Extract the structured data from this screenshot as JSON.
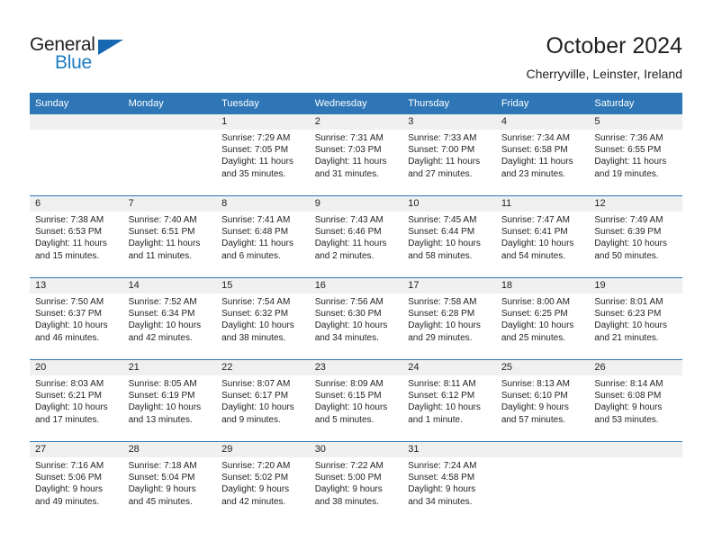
{
  "brand": {
    "name_top": "General",
    "name_bottom": "Blue",
    "triangle_icon": "triangle-icon",
    "accent_color": "#1c7cc3"
  },
  "header": {
    "title": "October 2024",
    "subtitle": "Cherryville, Leinster, Ireland"
  },
  "colors": {
    "header_blue": "#2e76b6",
    "day_band_gray": "#f0f0f0",
    "text": "#231f20"
  },
  "weekday_headers": [
    "Sunday",
    "Monday",
    "Tuesday",
    "Wednesday",
    "Thursday",
    "Friday",
    "Saturday"
  ],
  "labels": {
    "sunrise_prefix": "Sunrise:",
    "sunset_prefix": "Sunset:",
    "daylight_prefix": "Daylight:"
  },
  "weeks": [
    [
      {
        "day": "",
        "empty": true
      },
      {
        "day": "",
        "empty": true
      },
      {
        "day": "1",
        "sunrise": "Sunrise: 7:29 AM",
        "sunset": "Sunset: 7:05 PM",
        "daylight": "Daylight: 11 hours and 35 minutes."
      },
      {
        "day": "2",
        "sunrise": "Sunrise: 7:31 AM",
        "sunset": "Sunset: 7:03 PM",
        "daylight": "Daylight: 11 hours and 31 minutes."
      },
      {
        "day": "3",
        "sunrise": "Sunrise: 7:33 AM",
        "sunset": "Sunset: 7:00 PM",
        "daylight": "Daylight: 11 hours and 27 minutes."
      },
      {
        "day": "4",
        "sunrise": "Sunrise: 7:34 AM",
        "sunset": "Sunset: 6:58 PM",
        "daylight": "Daylight: 11 hours and 23 minutes."
      },
      {
        "day": "5",
        "sunrise": "Sunrise: 7:36 AM",
        "sunset": "Sunset: 6:55 PM",
        "daylight": "Daylight: 11 hours and 19 minutes."
      }
    ],
    [
      {
        "day": "6",
        "sunrise": "Sunrise: 7:38 AM",
        "sunset": "Sunset: 6:53 PM",
        "daylight": "Daylight: 11 hours and 15 minutes."
      },
      {
        "day": "7",
        "sunrise": "Sunrise: 7:40 AM",
        "sunset": "Sunset: 6:51 PM",
        "daylight": "Daylight: 11 hours and 11 minutes."
      },
      {
        "day": "8",
        "sunrise": "Sunrise: 7:41 AM",
        "sunset": "Sunset: 6:48 PM",
        "daylight": "Daylight: 11 hours and 6 minutes."
      },
      {
        "day": "9",
        "sunrise": "Sunrise: 7:43 AM",
        "sunset": "Sunset: 6:46 PM",
        "daylight": "Daylight: 11 hours and 2 minutes."
      },
      {
        "day": "10",
        "sunrise": "Sunrise: 7:45 AM",
        "sunset": "Sunset: 6:44 PM",
        "daylight": "Daylight: 10 hours and 58 minutes."
      },
      {
        "day": "11",
        "sunrise": "Sunrise: 7:47 AM",
        "sunset": "Sunset: 6:41 PM",
        "daylight": "Daylight: 10 hours and 54 minutes."
      },
      {
        "day": "12",
        "sunrise": "Sunrise: 7:49 AM",
        "sunset": "Sunset: 6:39 PM",
        "daylight": "Daylight: 10 hours and 50 minutes."
      }
    ],
    [
      {
        "day": "13",
        "sunrise": "Sunrise: 7:50 AM",
        "sunset": "Sunset: 6:37 PM",
        "daylight": "Daylight: 10 hours and 46 minutes."
      },
      {
        "day": "14",
        "sunrise": "Sunrise: 7:52 AM",
        "sunset": "Sunset: 6:34 PM",
        "daylight": "Daylight: 10 hours and 42 minutes."
      },
      {
        "day": "15",
        "sunrise": "Sunrise: 7:54 AM",
        "sunset": "Sunset: 6:32 PM",
        "daylight": "Daylight: 10 hours and 38 minutes."
      },
      {
        "day": "16",
        "sunrise": "Sunrise: 7:56 AM",
        "sunset": "Sunset: 6:30 PM",
        "daylight": "Daylight: 10 hours and 34 minutes."
      },
      {
        "day": "17",
        "sunrise": "Sunrise: 7:58 AM",
        "sunset": "Sunset: 6:28 PM",
        "daylight": "Daylight: 10 hours and 29 minutes."
      },
      {
        "day": "18",
        "sunrise": "Sunrise: 8:00 AM",
        "sunset": "Sunset: 6:25 PM",
        "daylight": "Daylight: 10 hours and 25 minutes."
      },
      {
        "day": "19",
        "sunrise": "Sunrise: 8:01 AM",
        "sunset": "Sunset: 6:23 PM",
        "daylight": "Daylight: 10 hours and 21 minutes."
      }
    ],
    [
      {
        "day": "20",
        "sunrise": "Sunrise: 8:03 AM",
        "sunset": "Sunset: 6:21 PM",
        "daylight": "Daylight: 10 hours and 17 minutes."
      },
      {
        "day": "21",
        "sunrise": "Sunrise: 8:05 AM",
        "sunset": "Sunset: 6:19 PM",
        "daylight": "Daylight: 10 hours and 13 minutes."
      },
      {
        "day": "22",
        "sunrise": "Sunrise: 8:07 AM",
        "sunset": "Sunset: 6:17 PM",
        "daylight": "Daylight: 10 hours and 9 minutes."
      },
      {
        "day": "23",
        "sunrise": "Sunrise: 8:09 AM",
        "sunset": "Sunset: 6:15 PM",
        "daylight": "Daylight: 10 hours and 5 minutes."
      },
      {
        "day": "24",
        "sunrise": "Sunrise: 8:11 AM",
        "sunset": "Sunset: 6:12 PM",
        "daylight": "Daylight: 10 hours and 1 minute."
      },
      {
        "day": "25",
        "sunrise": "Sunrise: 8:13 AM",
        "sunset": "Sunset: 6:10 PM",
        "daylight": "Daylight: 9 hours and 57 minutes."
      },
      {
        "day": "26",
        "sunrise": "Sunrise: 8:14 AM",
        "sunset": "Sunset: 6:08 PM",
        "daylight": "Daylight: 9 hours and 53 minutes."
      }
    ],
    [
      {
        "day": "27",
        "sunrise": "Sunrise: 7:16 AM",
        "sunset": "Sunset: 5:06 PM",
        "daylight": "Daylight: 9 hours and 49 minutes."
      },
      {
        "day": "28",
        "sunrise": "Sunrise: 7:18 AM",
        "sunset": "Sunset: 5:04 PM",
        "daylight": "Daylight: 9 hours and 45 minutes."
      },
      {
        "day": "29",
        "sunrise": "Sunrise: 7:20 AM",
        "sunset": "Sunset: 5:02 PM",
        "daylight": "Daylight: 9 hours and 42 minutes."
      },
      {
        "day": "30",
        "sunrise": "Sunrise: 7:22 AM",
        "sunset": "Sunset: 5:00 PM",
        "daylight": "Daylight: 9 hours and 38 minutes."
      },
      {
        "day": "31",
        "sunrise": "Sunrise: 7:24 AM",
        "sunset": "Sunset: 4:58 PM",
        "daylight": "Daylight: 9 hours and 34 minutes."
      },
      {
        "day": "",
        "empty": true
      },
      {
        "day": "",
        "empty": true
      }
    ]
  ]
}
